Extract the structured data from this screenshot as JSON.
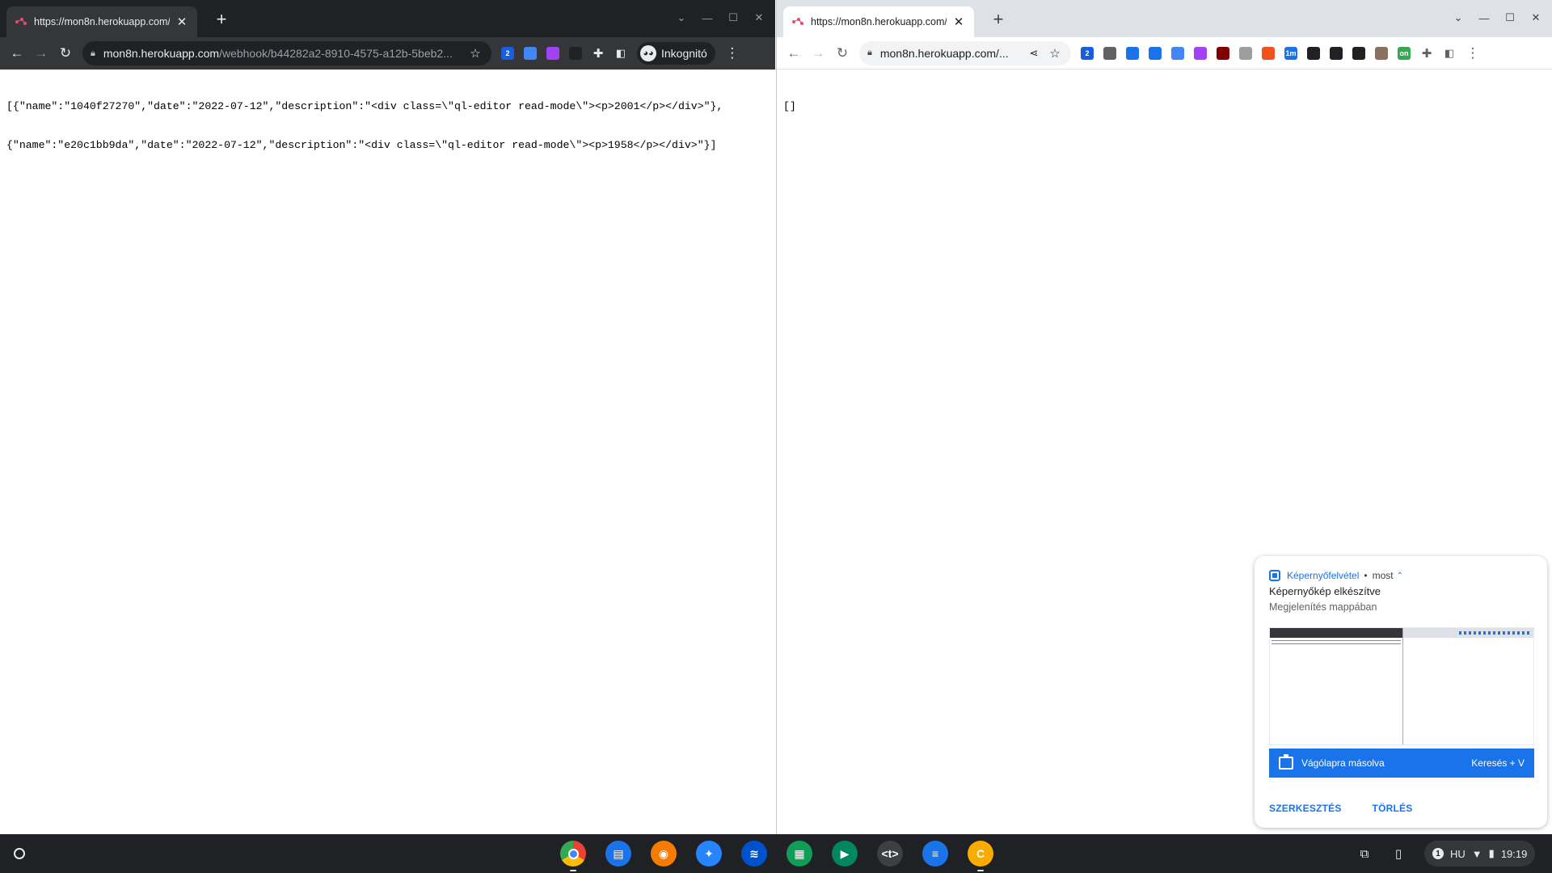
{
  "left_window": {
    "tab": {
      "title": "https://mon8n.herokuapp.com/"
    },
    "omnibox": {
      "host": "mon8n.herokuapp.com",
      "path": "/webhook/b44282a2-8910-4575-a12b-5beb2..."
    },
    "incognito_label": "Inkognitó",
    "extensions": [
      {
        "icon": "bitwarden-icon",
        "badge": "2",
        "color": "#175ddc"
      },
      {
        "icon": "google-translate-icon",
        "color": "#4285f4"
      },
      {
        "icon": "feather-icon",
        "color": "#a142f4"
      },
      {
        "icon": "cat-icon",
        "color": "#202124"
      }
    ],
    "content_lines": [
      "[{\"name\":\"1040f27270\",\"date\":\"2022-07-12\",\"description\":\"<div class=\\\"ql-editor read-mode\\\"><p>2001</p></div>\"},",
      "{\"name\":\"e20c1bb9da\",\"date\":\"2022-07-12\",\"description\":\"<div class=\\\"ql-editor read-mode\\\"><p>1958</p></div>\"}]"
    ]
  },
  "right_window": {
    "tab": {
      "title": "https://mon8n.herokuapp.com/"
    },
    "omnibox": {
      "host": "mon8n.herokuapp.com/..."
    },
    "extensions": [
      {
        "icon": "bitwarden-icon",
        "badge": "2",
        "color": "#175ddc"
      },
      {
        "icon": "scan-icon",
        "color": "#5f6368"
      },
      {
        "icon": "d-icon",
        "color": "#1a73e8"
      },
      {
        "icon": "reader-icon",
        "color": "#1a73e8"
      },
      {
        "icon": "google-translate-icon",
        "color": "#4285f4"
      },
      {
        "icon": "feather-icon",
        "color": "#a142f4"
      },
      {
        "icon": "ublock-icon",
        "color": "#800000"
      },
      {
        "icon": "owl-icon",
        "color": "#9e9e9e"
      },
      {
        "icon": "orange-circle-icon",
        "color": "#f4511e"
      },
      {
        "icon": "timer-icon",
        "badge": "1m",
        "color": "#1a73e8"
      },
      {
        "icon": "ninja-icon",
        "color": "#202124"
      },
      {
        "icon": "terminal-icon",
        "color": "#202124"
      },
      {
        "icon": "devtools-icon",
        "color": "#202124"
      },
      {
        "icon": "cookie-icon",
        "color": "#8d6e63"
      },
      {
        "icon": "checklist-icon",
        "badge": "on",
        "color": "#34a853"
      }
    ],
    "content": "[]"
  },
  "notification": {
    "app_name": "Képernyőfelvétel",
    "time": "most",
    "title": "Képernyőkép elkészítve",
    "subtitle": "Megjelenítés mappában",
    "action_label": "Vágólapra másolva",
    "action_shortcut": "Keresés + V",
    "edit_button": "SZERKESZTÉS",
    "delete_button": "TÖRLÉS",
    "accent": "#1a73e8"
  },
  "shelf": {
    "apps": [
      {
        "name": "chrome-app-icon",
        "glyph": "",
        "color": "#4285f4",
        "running": true
      },
      {
        "name": "files-app-icon",
        "glyph": "▤",
        "color": "#1a73e8",
        "running": false
      },
      {
        "name": "keyhole-app-icon",
        "glyph": "◉",
        "color": "#f57c00",
        "running": false
      },
      {
        "name": "jira-app-icon",
        "glyph": "✦",
        "color": "#2684ff",
        "running": false
      },
      {
        "name": "confluence-app-icon",
        "glyph": "≋",
        "color": "#0052cc",
        "running": false
      },
      {
        "name": "sheets-app-icon",
        "glyph": "▦",
        "color": "#0f9d58",
        "running": false
      },
      {
        "name": "play-store-app-icon",
        "glyph": "▶",
        "color": "#01875f",
        "running": false
      },
      {
        "name": "terminal-app-icon",
        "glyph": "<t>",
        "color": "#3c4043",
        "running": false
      },
      {
        "name": "messages-app-icon",
        "glyph": "≡",
        "color": "#1a73e8",
        "running": false
      },
      {
        "name": "c-app-icon",
        "glyph": "C",
        "color": "#f9ab00",
        "running": true
      }
    ],
    "notification_count": "1",
    "language": "HU",
    "clock": "19:19"
  }
}
